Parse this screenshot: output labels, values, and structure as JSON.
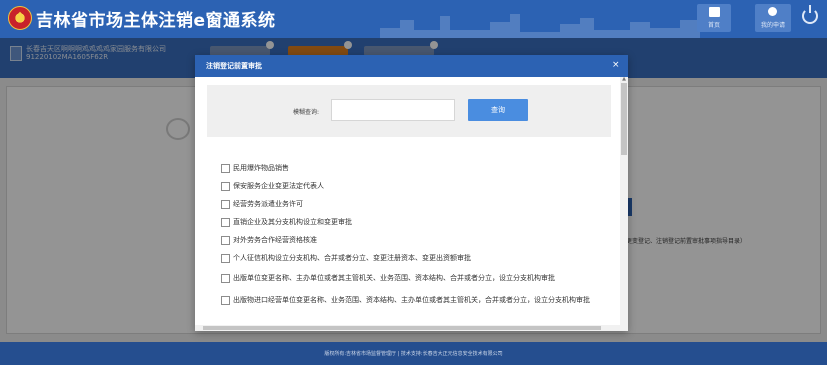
{
  "header": {
    "site_title": "吉林省市场主体注销e窗通系统",
    "home_label": "首页",
    "applications_label": "我的申请"
  },
  "subbar": {
    "company_name": "长春吉天区啊啊啊鸡鸡鸡鸡家园服务有限公司",
    "credit_code": "91220102MA1605F62R"
  },
  "background": {
    "hint_text": "更变登记、注销登记前置审批事项指导目录）"
  },
  "modal": {
    "title": "注销登记前置审批",
    "close_symbol": "×",
    "search_label": "模糊查询:",
    "search_value": "",
    "search_placeholder": "",
    "search_button": "查询",
    "items": [
      "民用爆炸物品销售",
      "保安服务企业变更法定代表人",
      "经营劳务派遣业务许可",
      "直销企业及其分支机构设立和变更审批",
      "对外劳务合作经营资格核准",
      "个人征信机构设立分支机构、合并或者分立、变更注册资本、变更出资额审批",
      "出版单位变更名称、主办单位或者其主管机关、业务范围、资本结构、合并或者分立，设立分支机构审批",
      "出版物进口经营单位变更名称、业务范围、资本结构、主办单位或者其主管机关，合并或者分立，设立分支机构审批"
    ]
  },
  "footer": {
    "text": "版权所有:吉林省市场监督管理厅 | 技术支持:长春吉大正元信息安全技术有限公司"
  },
  "colors": {
    "header_blue": "#2c62b3",
    "button_blue": "#4a8de0",
    "footer_blue": "#254e8f",
    "active_tab_orange": "#e0801e"
  }
}
